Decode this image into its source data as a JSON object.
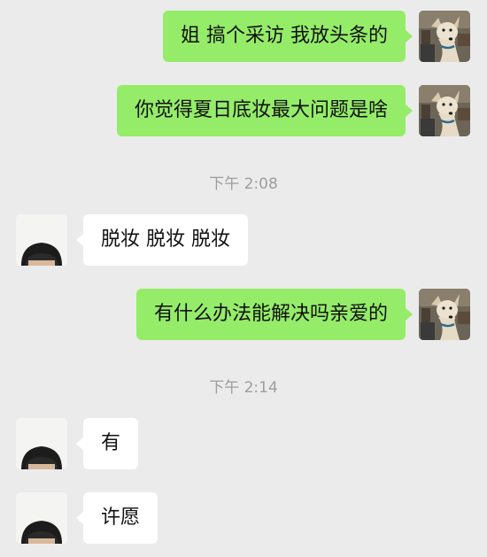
{
  "messages": [
    {
      "sender": "me",
      "text": "姐 搞个采访 我放头条的"
    },
    {
      "sender": "me",
      "text": "你觉得夏日底妆最大问题是啥"
    },
    {
      "type": "time",
      "text": "下午 2:08"
    },
    {
      "sender": "other",
      "text": "脱妆 脱妆 脱妆"
    },
    {
      "sender": "me",
      "text": "有什么办法能解决吗亲爱的"
    },
    {
      "type": "time",
      "text": "下午 2:14"
    },
    {
      "sender": "other",
      "text": "有"
    },
    {
      "sender": "other",
      "text": "许愿"
    }
  ],
  "colors": {
    "background": "#ebebeb",
    "outgoing_bubble": "#95ec69",
    "incoming_bubble": "#ffffff",
    "timestamp": "#9e9e9e"
  },
  "icons": {
    "my_avatar": "dog-avatar-icon",
    "contact_avatar": "person-avatar-icon"
  }
}
